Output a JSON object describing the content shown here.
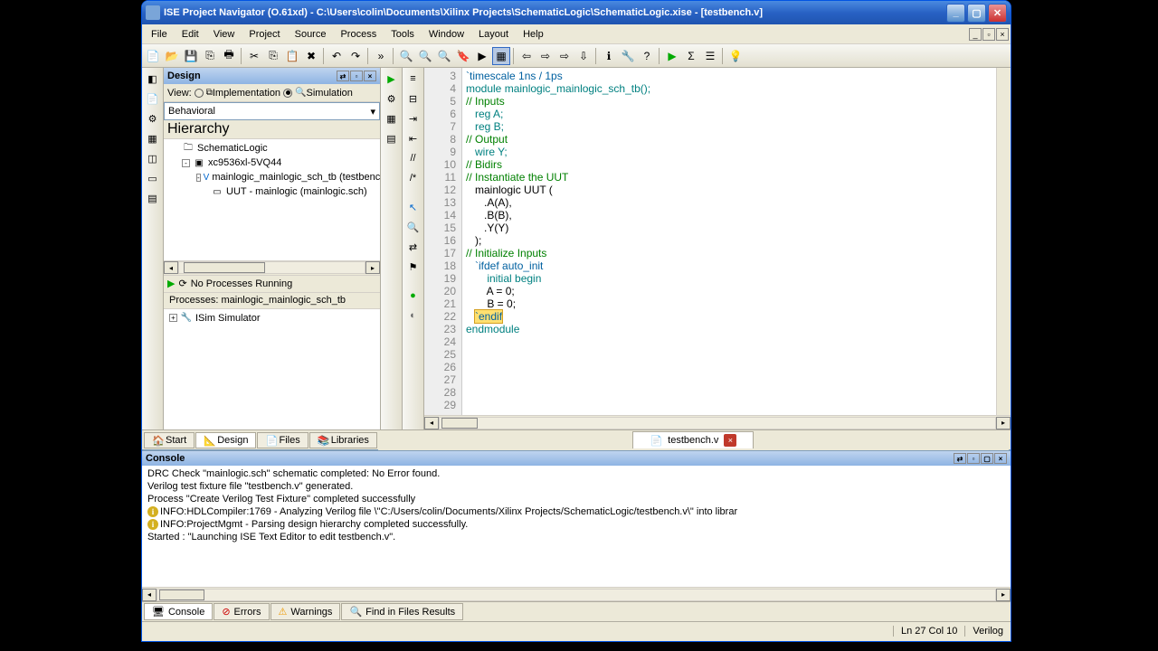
{
  "window": {
    "title": "ISE Project Navigator (O.61xd) - C:\\Users\\colin\\Documents\\Xilinx Projects\\SchematicLogic\\SchematicLogic.xise - [testbench.v]"
  },
  "menu": {
    "file": "File",
    "edit": "Edit",
    "view": "View",
    "project": "Project",
    "source": "Source",
    "process": "Process",
    "tools": "Tools",
    "window": "Window",
    "layout": "Layout",
    "help": "Help"
  },
  "design": {
    "panel_title": "Design",
    "view_label": "View:",
    "impl": "Implementation",
    "sim": "Simulation",
    "behavioral": "Behavioral",
    "hierarchy": "Hierarchy",
    "tree": {
      "root": "SchematicLogic",
      "device": "xc9536xl-5VQ44",
      "tb": "mainlogic_mainlogic_sch_tb (testbench.v)",
      "uut": "UUT - mainlogic (mainlogic.sch)"
    },
    "no_proc": "No Processes Running",
    "proc_title": "Processes: mainlogic_mainlogic_sch_tb",
    "isim": "ISim Simulator"
  },
  "bottom_tabs": {
    "start": "Start",
    "design": "Design",
    "files": "Files",
    "libraries": "Libraries"
  },
  "editor": {
    "tab_name": "testbench.v",
    "first_line": 3,
    "code_lines": [
      {
        "t": "`timescale 1ns / 1ps",
        "c": "dir"
      },
      {
        "t": "",
        "c": ""
      },
      {
        "t": "module mainlogic_mainlogic_sch_tb();",
        "c": "kw"
      },
      {
        "t": "",
        "c": ""
      },
      {
        "t": "// Inputs",
        "c": "cm"
      },
      {
        "t": "   reg A;",
        "c": "kw"
      },
      {
        "t": "   reg B;",
        "c": "kw"
      },
      {
        "t": "",
        "c": ""
      },
      {
        "t": "// Output",
        "c": "cm"
      },
      {
        "t": "   wire Y;",
        "c": "kw"
      },
      {
        "t": "",
        "c": ""
      },
      {
        "t": "// Bidirs",
        "c": "cm"
      },
      {
        "t": "",
        "c": ""
      },
      {
        "t": "// Instantiate the UUT",
        "c": "cm"
      },
      {
        "t": "   mainlogic UUT (",
        "c": ""
      },
      {
        "t": "      .A(A), ",
        "c": ""
      },
      {
        "t": "      .B(B), ",
        "c": ""
      },
      {
        "t": "      .Y(Y)",
        "c": ""
      },
      {
        "t": "   );",
        "c": ""
      },
      {
        "t": "// Initialize Inputs",
        "c": "cm"
      },
      {
        "t": "   `ifdef auto_init",
        "c": "dir"
      },
      {
        "t": "       initial begin",
        "c": "kw"
      },
      {
        "t": "       A = 0;",
        "c": ""
      },
      {
        "t": "       B = 0;",
        "c": ""
      },
      {
        "t": "   `endif",
        "c": "dir",
        "hl": true
      },
      {
        "t": "endmodule",
        "c": "kw"
      },
      {
        "t": "",
        "c": ""
      }
    ]
  },
  "console": {
    "title": "Console",
    "lines": [
      "DRC Check \"mainlogic.sch\" schematic completed: No Error found.",
      "Verilog test fixture file \"testbench.v\" generated.",
      "",
      "Process \"Create Verilog Test Fixture\" completed successfully",
      "INFO:HDLCompiler:1769 - Analyzing Verilog file \\\"C:/Users/colin/Documents/Xilinx Projects/SchematicLogic/testbench.v\\\" into librar",
      "INFO:ProjectMgmt - Parsing design hierarchy completed successfully.",
      "",
      "Started : \"Launching ISE Text Editor to edit testbench.v\"."
    ],
    "tabs": {
      "console": "Console",
      "errors": "Errors",
      "warnings": "Warnings",
      "find": "Find in Files Results"
    }
  },
  "status": {
    "pos": "Ln 27 Col 10",
    "lang": "Verilog"
  }
}
